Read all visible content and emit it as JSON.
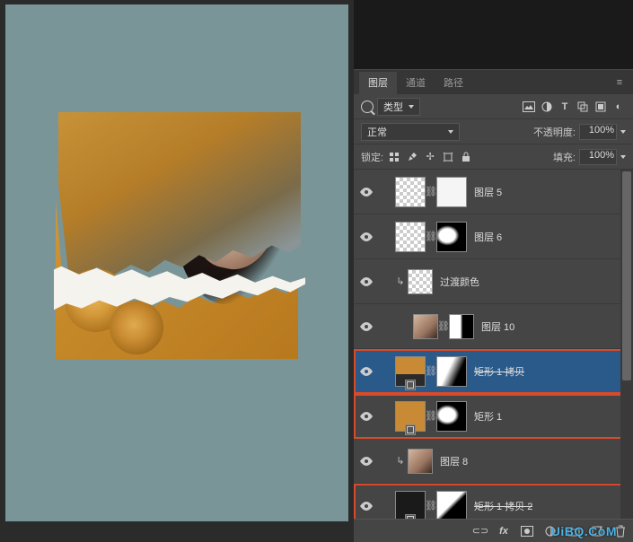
{
  "tabs": {
    "layers": "图层",
    "channels": "通道",
    "paths": "路径"
  },
  "filter": {
    "kind_label": "类型"
  },
  "blend": {
    "mode": "正常",
    "opacity_label": "不透明度:",
    "opacity_value": "100%"
  },
  "lock": {
    "label": "锁定:",
    "fill_label": "填充:",
    "fill_value": "100%"
  },
  "layers": [
    {
      "name": "图层 5"
    },
    {
      "name": "图层 6"
    },
    {
      "name": "过渡颜色"
    },
    {
      "name": "图层 10"
    },
    {
      "name": "矩形 1 拷贝"
    },
    {
      "name": "矩形 1"
    },
    {
      "name": "图层 8"
    },
    {
      "name": "矩形 1 拷贝 2"
    }
  ],
  "bottom_icons": {
    "fx": "fx"
  },
  "watermark": "UiBQ.CoM"
}
